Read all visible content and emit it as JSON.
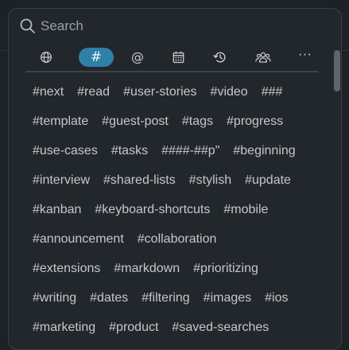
{
  "search": {
    "placeholder": "Search",
    "value": ""
  },
  "filter_tabs": [
    {
      "name": "tab-all",
      "icon": "globe-icon",
      "active": false
    },
    {
      "name": "tab-tags",
      "icon": "hash-icon",
      "label": "#",
      "active": true
    },
    {
      "name": "tab-mentions",
      "icon": "at-icon",
      "label": "@",
      "active": false
    },
    {
      "name": "tab-dates",
      "icon": "calendar-icon",
      "active": false
    },
    {
      "name": "tab-recent",
      "icon": "history-icon",
      "active": false
    },
    {
      "name": "tab-people",
      "icon": "people-icon",
      "active": false
    },
    {
      "name": "tab-more",
      "icon": "more-icon",
      "label": "···",
      "active": false
    }
  ],
  "tag_rows": [
    [
      "#next",
      "#read",
      "#user-stories",
      "#video",
      "###"
    ],
    [
      "#template",
      "#guest-post",
      "#tags",
      "#progress"
    ],
    [
      "#use-cases",
      "#tasks",
      "####-##p\"",
      "#beginning"
    ],
    [
      "#interview",
      "#shared-lists",
      "#stylish",
      "#update"
    ],
    [
      "#kanban",
      "#keyboard-shortcuts",
      "#mobile"
    ],
    [
      "#announcement",
      "#collaboration"
    ],
    [
      "#extensions",
      "#markdown",
      "#prioritizing"
    ],
    [
      "#writing",
      "#dates",
      "#filtering",
      "#images",
      "#ios"
    ],
    [
      "#marketing",
      "#product",
      "#saved-searches"
    ]
  ],
  "colors": {
    "background": "#1d2226",
    "panel": "#22272b",
    "accent": "#2f7fa8",
    "text": "#c4c8cc"
  }
}
